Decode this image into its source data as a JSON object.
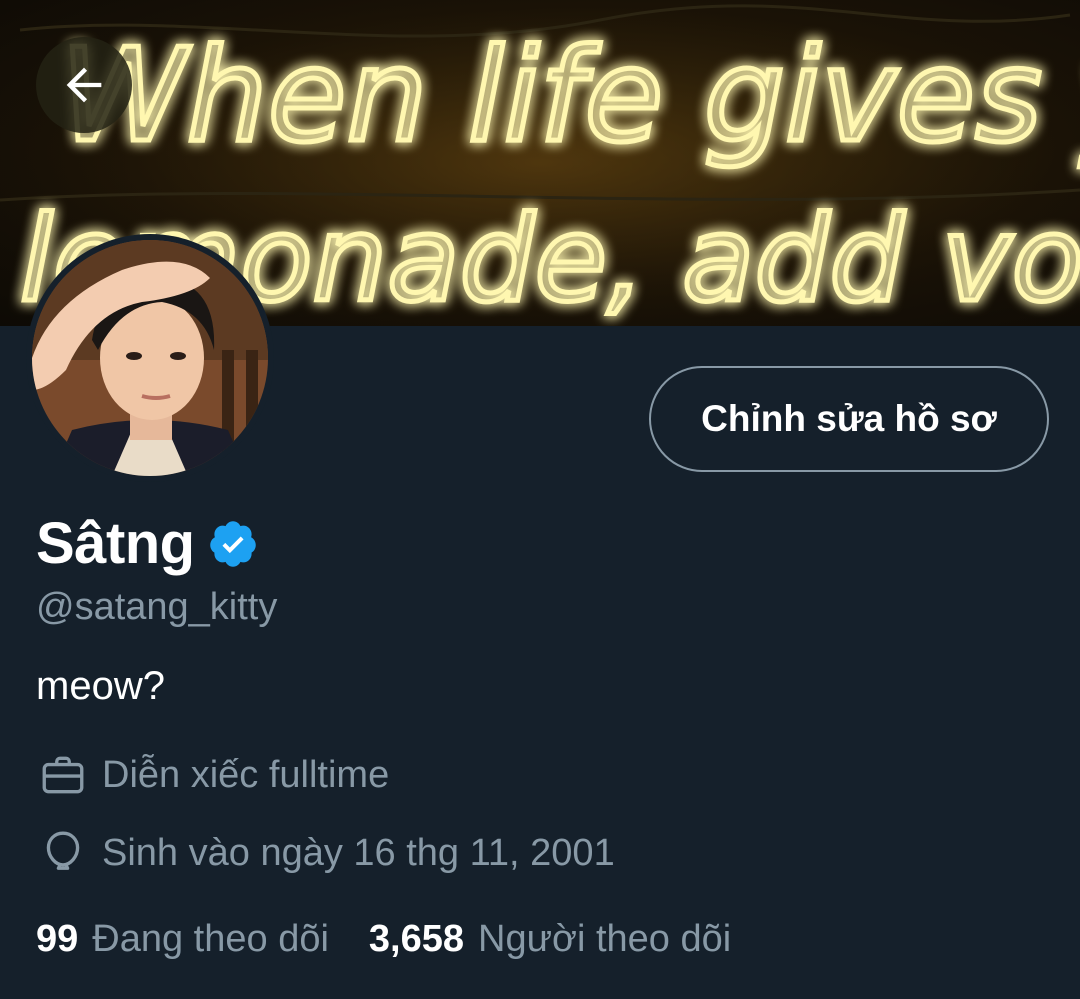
{
  "banner": {
    "line1": "When life gives you",
    "line2": "lemonade, add vodka."
  },
  "profile": {
    "display_name": "Sâtng",
    "handle": "@satang_kitty",
    "bio": "meow?",
    "verified": true,
    "job": "Diễn xiếc fulltime",
    "birth": "Sinh vào ngày 16 thg 11, 2001"
  },
  "actions": {
    "edit_profile_label": "Chỉnh sửa hồ sơ"
  },
  "stats": {
    "following_count": "99",
    "following_label": "Đang theo dõi",
    "followers_count": "3,658",
    "followers_label": "Người theo dõi"
  },
  "icons": {
    "back": "back-arrow-icon",
    "verified": "verified-badge-icon",
    "job": "briefcase-icon",
    "birth": "balloon-icon"
  },
  "colors": {
    "background": "#15202b",
    "secondary_text": "#8899a6",
    "verified_blue": "#1da1f2",
    "neon_yellow": "#f4e45a"
  }
}
